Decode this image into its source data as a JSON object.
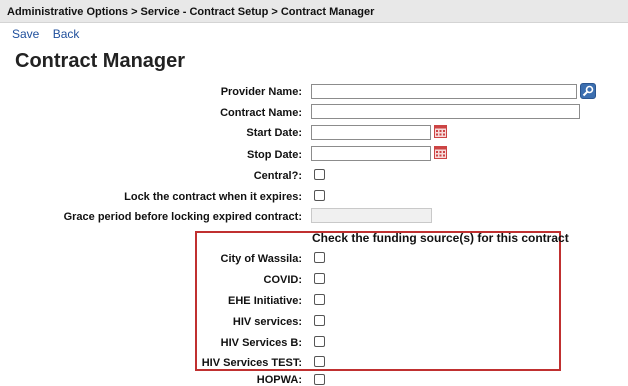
{
  "breadcrumb": "Administrative Options > Service - Contract Setup > Contract Manager",
  "toolbar": {
    "save_label": "Save",
    "back_label": "Back"
  },
  "page_title": "Contract Manager",
  "form": {
    "provider_name_label": "Provider Name:",
    "contract_name_label": "Contract Name:",
    "start_date_label": "Start Date:",
    "stop_date_label": "Stop Date:",
    "central_label": "Central?:",
    "lock_label": "Lock the contract when it expires:",
    "grace_label": "Grace period before locking expired contract:"
  },
  "funding": {
    "title": "Check the funding source(s) for this contract",
    "sources": [
      "City of Wassila:",
      "COVID:",
      "EHE Initiative:",
      "HIV services:",
      "HIV Services B:",
      "HIV Services TEST:",
      "HOPWA:"
    ]
  },
  "icons": {
    "search": "search-icon",
    "calendar": "calendar-icon"
  },
  "colors": {
    "link": "#1f4f9c",
    "highlight_border": "#c03030"
  }
}
